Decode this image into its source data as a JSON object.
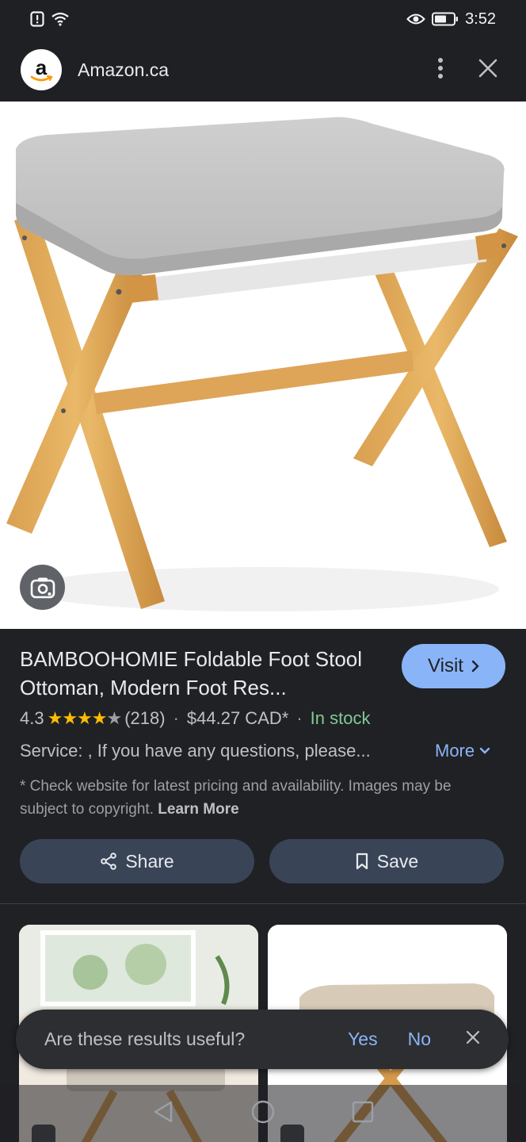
{
  "status_bar": {
    "time": "3:52"
  },
  "browser": {
    "site_logo_letter": "a",
    "site_title": "Amazon.ca"
  },
  "product": {
    "title": "BAMBOOHOMIE Foldable Foot Stool Ottoman, Modern Foot Res...",
    "visit_label": "Visit",
    "rating": "4.3",
    "rating_stars_filled": 4,
    "review_count": "(218)",
    "price": "$44.27 CAD*",
    "stock": "In stock",
    "service_text": "Service: , If you have any questions, please...",
    "more_label": "More",
    "disclaimer": "* Check website for latest pricing and availability. Images may be subject to copyright.",
    "learn_more": "Learn More",
    "share_label": "Share",
    "save_label": "Save"
  },
  "feedback": {
    "question": "Are these results useful?",
    "yes": "Yes",
    "no": "No"
  },
  "colors": {
    "accent": "#8ab4f8",
    "star": "#fbbc04",
    "in_stock": "#81c995",
    "background": "#202124"
  }
}
